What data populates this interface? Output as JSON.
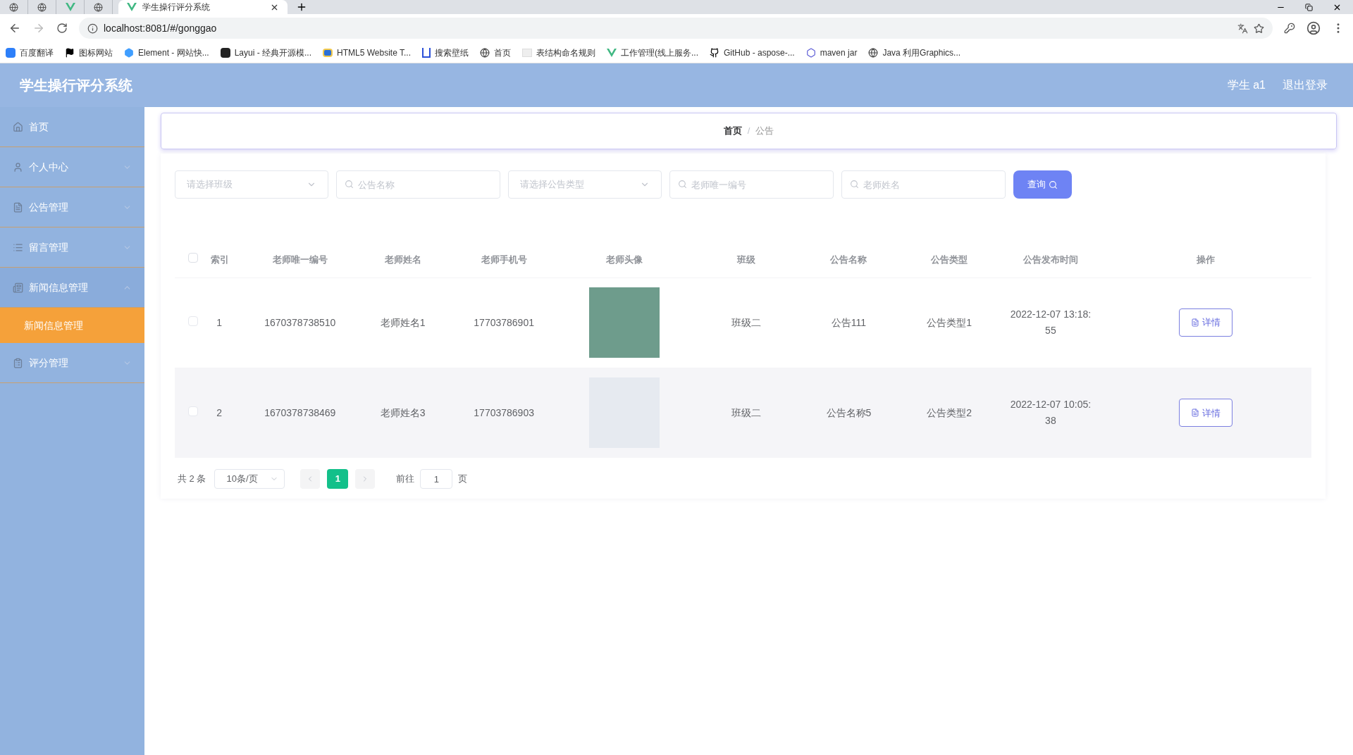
{
  "browser": {
    "tabs": [
      {
        "kind": "icon",
        "selected": false
      },
      {
        "kind": "icon",
        "selected": false
      },
      {
        "kind": "icon",
        "selected": false
      },
      {
        "kind": "icon",
        "selected": false
      },
      {
        "kind": "page",
        "title": "学生操行评分系统",
        "selected": true
      }
    ],
    "address": "localhost:8081/#/gonggao",
    "bookmarks": [
      {
        "kind": "translate",
        "label": "百度翻译"
      },
      {
        "kind": "flag",
        "label": "图标网站"
      },
      {
        "kind": "hex",
        "label": "Element - 网站快..."
      },
      {
        "kind": "layui",
        "label": "Layui - 经典开源模..."
      },
      {
        "kind": "html5",
        "label": "HTML5 Website T..."
      },
      {
        "kind": "wallpaper",
        "label": "搜索壁纸"
      },
      {
        "kind": "globe",
        "label": "首页"
      },
      {
        "kind": "blank",
        "label": "表结构命名规则"
      },
      {
        "kind": "vue",
        "label": "工作管理(线上服务..."
      },
      {
        "kind": "github",
        "label": "GitHub - aspose-..."
      },
      {
        "kind": "maven",
        "label": "maven jar"
      },
      {
        "kind": "globe",
        "label": "Java 利用Graphics..."
      }
    ]
  },
  "app": {
    "title": "学生操行评分系统",
    "user": "学生 a1",
    "logout": "退出登录"
  },
  "sidebar": {
    "items": [
      {
        "kind": "link",
        "label": "首页"
      },
      {
        "kind": "submenu",
        "label": "个人中心",
        "expanded": false
      },
      {
        "kind": "submenu",
        "label": "公告管理",
        "expanded": false
      },
      {
        "kind": "submenu",
        "label": "留言管理",
        "expanded": false
      },
      {
        "kind": "submenu",
        "label": "新闻信息管理",
        "expanded": true,
        "children": [
          {
            "label": "新闻信息管理",
            "selected": true
          }
        ]
      },
      {
        "kind": "submenu",
        "label": "评分管理",
        "expanded": false
      }
    ]
  },
  "breadcrumb": [
    {
      "label": "首页"
    },
    {
      "label": "公告"
    }
  ],
  "breadcrumb_separator": "/",
  "filters": [
    {
      "kind": "select",
      "placeholder": "请选择班级"
    },
    {
      "kind": "search",
      "placeholder": "公告名称"
    },
    {
      "kind": "select",
      "placeholder": "请选择公告类型"
    },
    {
      "kind": "search",
      "placeholder": "老师唯一编号"
    },
    {
      "kind": "search",
      "placeholder": "老师姓名"
    }
  ],
  "query_button": "查询",
  "table": {
    "select_all": false,
    "columns": [
      "索引",
      "老师唯一编号",
      "老师姓名",
      "老师手机号",
      "老师头像",
      "班级",
      "公告名称",
      "公告类型",
      "公告发布时间",
      "操作"
    ],
    "rows": [
      {
        "checked": false,
        "cells": [
          "1",
          "1670378738510",
          "老师姓名1",
          "17703786901",
          "",
          "班级二",
          "公告111",
          "公告类型1",
          "2022-12-07 13:18:55"
        ],
        "action": "详情"
      },
      {
        "checked": false,
        "cells": [
          "2",
          "1670378738469",
          "老师姓名3",
          "17703786903",
          "",
          "班级二",
          "公告名称5",
          "公告类型2",
          "2022-12-07 10:05:38"
        ],
        "action": "详情"
      }
    ]
  },
  "pagination": {
    "total": "共 2 条",
    "page_size": "10条/页",
    "pages": [
      {
        "label": "1",
        "selected": true
      }
    ],
    "goto_label": "前往",
    "goto_value": "1",
    "goto_suffix": "页"
  }
}
